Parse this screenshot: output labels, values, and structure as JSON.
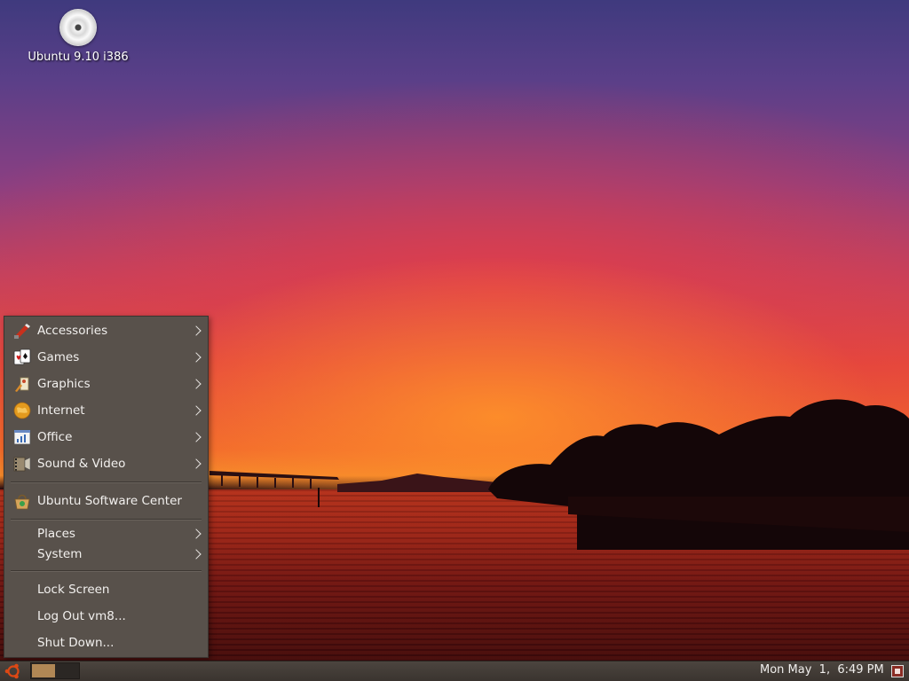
{
  "desktop": {
    "icons": [
      {
        "label": "Ubuntu 9.10 i386",
        "icon": "cd-disc-icon"
      }
    ]
  },
  "applications_menu": {
    "items": [
      {
        "label": "Accessories",
        "icon": "accessories-icon",
        "submenu": true
      },
      {
        "label": "Games",
        "icon": "games-icon",
        "submenu": true
      },
      {
        "label": "Graphics",
        "icon": "graphics-icon",
        "submenu": true
      },
      {
        "label": "Internet",
        "icon": "internet-icon",
        "submenu": true
      },
      {
        "label": "Office",
        "icon": "office-icon",
        "submenu": true
      },
      {
        "label": "Sound & Video",
        "icon": "sound-video-icon",
        "submenu": true
      },
      {
        "label": "Ubuntu Software Center",
        "icon": "software-center-icon",
        "submenu": false
      },
      {
        "label": "Places",
        "icon": "",
        "submenu": true
      },
      {
        "label": "System",
        "icon": "",
        "submenu": true
      },
      {
        "label": "Lock Screen",
        "icon": "",
        "submenu": false
      },
      {
        "label": "Log Out vm8...",
        "icon": "",
        "submenu": false
      },
      {
        "label": "Shut Down...",
        "icon": "",
        "submenu": false
      }
    ]
  },
  "panel": {
    "clock": "Mon May  1,  6:49 PM",
    "menu_icon": "ubuntu-logo-icon",
    "workspace_icon": "workspace-switcher-icon",
    "logout_icon": "logout-icon"
  },
  "colors": {
    "menu_bg": "#58514b",
    "panel_bg": "#3f3934",
    "menu_text": "#f2f0ee",
    "ubuntu_orange": "#dd4814"
  }
}
